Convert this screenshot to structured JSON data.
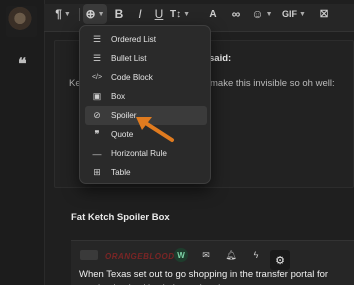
{
  "toolbar": {
    "items": [
      {
        "name": "paragraph-icon",
        "glyph": "¶"
      },
      {
        "name": "insert-icon",
        "glyph": "⊕"
      },
      {
        "name": "bold-icon",
        "glyph": "B"
      },
      {
        "name": "italic-icon",
        "glyph": "I"
      },
      {
        "name": "underline-icon",
        "glyph": "U"
      },
      {
        "name": "text-size-icon",
        "glyph": "T↕"
      },
      {
        "name": "text-style-icon",
        "glyph": "A"
      },
      {
        "name": "link-icon",
        "glyph": "∞"
      },
      {
        "name": "emoji-icon",
        "glyph": "☺"
      },
      {
        "name": "gif-label",
        "glyph": "GIF"
      },
      {
        "name": "clear-format-icon",
        "glyph": "⛝"
      }
    ]
  },
  "menu": {
    "items": [
      {
        "name": "menu-item-ordered-list",
        "icon": "ordered-list-icon",
        "glyph": "☰",
        "label": "Ordered List"
      },
      {
        "name": "menu-item-bullet-list",
        "icon": "bullet-list-icon",
        "glyph": "☰",
        "label": "Bullet List"
      },
      {
        "name": "menu-item-code-block",
        "icon": "code-block-icon",
        "glyph": "</>",
        "label": "Code Block"
      },
      {
        "name": "menu-item-box",
        "icon": "box-icon",
        "glyph": "▣",
        "label": "Box"
      },
      {
        "name": "menu-item-spoiler",
        "icon": "eye-slash-icon",
        "glyph": "◌",
        "label": "Spoiler"
      },
      {
        "name": "menu-item-quote",
        "icon": "quote-icon",
        "glyph": "❞",
        "label": "Quote"
      },
      {
        "name": "menu-item-horizontal-rule",
        "icon": "horizontal-rule-icon",
        "glyph": "—",
        "label": "Horizontal Rule"
      },
      {
        "name": "menu-item-table",
        "icon": "table-icon",
        "glyph": "⊞",
        "label": "Table"
      }
    ],
    "hovered": "Spoiler"
  },
  "quote": {
    "said": "said:",
    "line_left": "Ke",
    "line_right": "make this invisible so oh well:"
  },
  "post": {
    "section_title": "Fat Ketch Spoiler Box",
    "brand": "ORANGEBLOODS",
    "embed_w": "W",
    "article_text": "When Texas set out to go shopping in the transfer portal for running backs, it's obvious what the"
  },
  "colors": {
    "arrow": "#e07b1f",
    "menu_bg": "#2a2a2a",
    "hover_bg": "#3b3b3b"
  }
}
